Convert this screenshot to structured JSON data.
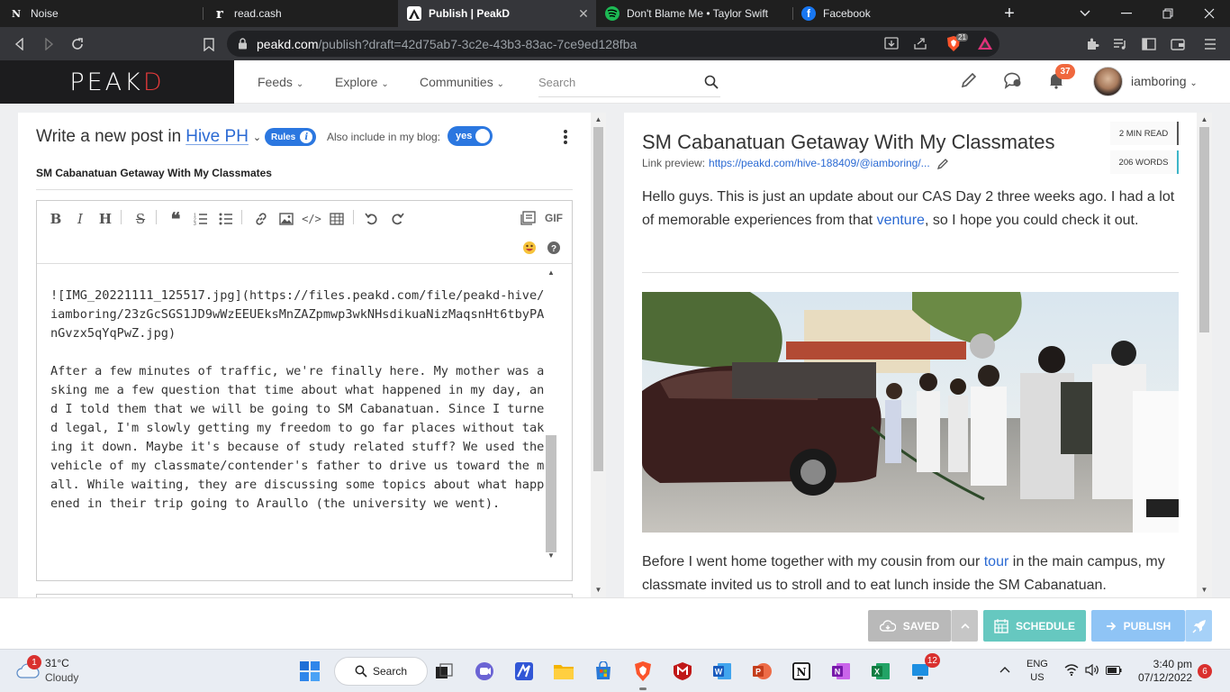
{
  "browser": {
    "tabs": [
      {
        "title": "Noise",
        "favicon": "N",
        "active": false
      },
      {
        "title": "read.cash",
        "favicon": "r",
        "active": false
      },
      {
        "title": "Publish | PeakD",
        "favicon": "peakd-icon",
        "active": true
      },
      {
        "title": "Don't Blame Me • Taylor Swift",
        "favicon": "spotify-icon",
        "active": false
      },
      {
        "title": "Facebook",
        "favicon": "facebook-icon",
        "active": false
      }
    ],
    "url_domain": "peakd.com",
    "url_path": "/publish?draft=42d75ab7-3c2e-43b3-83ac-7ce9ed128fba",
    "shield_count": "21"
  },
  "header": {
    "logo_main": "PEAK",
    "logo_d": "D",
    "nav": [
      "Feeds",
      "Explore",
      "Communities"
    ],
    "search_placeholder": "Search",
    "notifications": "37",
    "username": "iamboring"
  },
  "editor": {
    "title_prefix": "Write a new post in",
    "community": "Hive PH",
    "rules_label": "Rules",
    "also_label": "Also include in my blog:",
    "toggle_label": "yes",
    "post_title": "SM Cabanatuan Getaway With My Classmates",
    "gif_label": "GIF",
    "body_text": "![IMG_20221111_125517.jpg](https://files.peakd.com/file/peakd-hive/iamboring/23zGcSGS1JD9wWzEEUEksMnZAZpmwp3wkNHsdikuaNizMaqsnHt6tbyPAnGvzx5qYqPwZ.jpg)\n\nAfter a few minutes of traffic, we're finally here. My mother was asking me a few question that time about what happened in my day, and I told them that we will be going to SM Cabanatuan. Since I turned legal, I'm slowly getting my freedom to go far places without taking it down. Maybe it's because of study related stuff? We used the vehicle of my classmate/contender's father to drive us toward the mall. While waiting, they are discussing some topics about what happened in their trip going to Araullo (the university we went)."
  },
  "preview": {
    "title": "SM Cabanatuan Getaway With My Classmates",
    "link_label": "Link preview:",
    "link_text": "https://peakd.com/hive-188409/@iamboring/...",
    "read_time": "2 MIN READ",
    "word_count": "206 WORDS",
    "p1_a": "Hello guys. This is just an update about our CAS Day 2 three weeks ago. I had a lot of memorable experiences from that ",
    "p1_link": "venture",
    "p1_b": ", so I hope you could check it out.",
    "p2_a": "Before I went home together with my cousin from our ",
    "p2_link": "tour",
    "p2_b": " in the main campus, my classmate invited us to stroll and to eat lunch inside the SM Cabanatuan."
  },
  "actions": {
    "saved": "SAVED",
    "schedule": "SCHEDULE",
    "publish": "PUBLISH"
  },
  "taskbar": {
    "weather_temp": "31°C",
    "weather_desc": "Cloudy",
    "weather_badge": "1",
    "search_label": "Search",
    "app_badge": "12",
    "lang1": "ENG",
    "lang2": "US",
    "time": "3:40 pm",
    "date": "07/12/2022",
    "notif_badge": "6"
  },
  "colors": {
    "accent": "#2b77e0",
    "peakd_red": "#e33a3a",
    "saved_btn": "#b9b9b9",
    "schedule_btn": "#66c8c0",
    "publish_btn": "#8fc4f5"
  }
}
